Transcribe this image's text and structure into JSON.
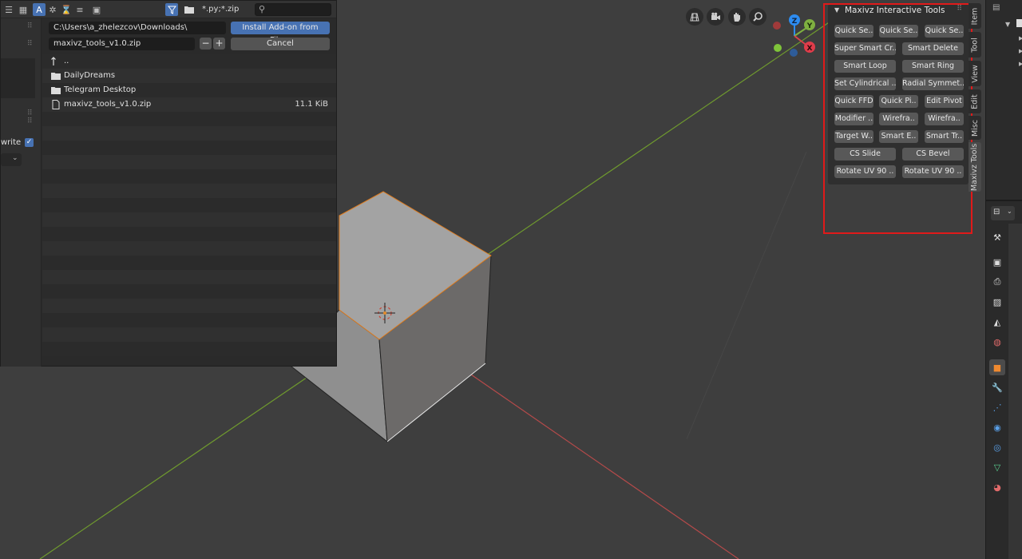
{
  "file_browser": {
    "filter_text": "*.py;*.zip",
    "directory_path": "C:\\Users\\a_zhelezcov\\Downloads\\",
    "filename": "maxivz_tools_v1.0.zip",
    "install_button": "Install Add-on from File...",
    "cancel_button": "Cancel",
    "decrement_label": "−",
    "increment_label": "+",
    "overwrite_label": "write",
    "files": [
      {
        "name": "..",
        "type": "parent",
        "size": ""
      },
      {
        "name": "DailyDreams",
        "type": "folder",
        "size": ""
      },
      {
        "name": "Telegram Desktop",
        "type": "folder",
        "size": ""
      },
      {
        "name": "maxivz_tools_v1.0.zip",
        "type": "file",
        "size": "11.1 KiB"
      }
    ]
  },
  "panel": {
    "title": "Maxivz Interactive Tools",
    "buttons": [
      "Quick Se..",
      "Quick Se..",
      "Quick Se..",
      "Super Smart Cr..",
      "Smart Delete",
      "Smart Loop",
      "Smart Ring",
      "Set Cylindrical ..",
      "Radial Symmet..",
      "Quick FFD",
      "Quick Pi..",
      "Edit Pivot",
      "Modifier ..",
      "Wirefra..",
      "Wirefra..",
      "Target W..",
      "Smart E..",
      "Smart Tr..",
      "CS Slide",
      "CS Bevel",
      "Rotate UV 90 ..",
      "Rotate UV 90 .."
    ]
  },
  "sidebar_tabs": [
    "Item",
    "Tool",
    "View",
    "Edit",
    "Misc",
    "Maxivz Tools"
  ],
  "gizmo": {
    "z_label": "Z",
    "y_label": "Y",
    "x_label": "X"
  },
  "colors": {
    "accent": "#4772b3",
    "highlight": "#e01a1a",
    "x_axis": "#d8414a",
    "y_axis": "#8bc34a",
    "z_axis": "#2d8cf0"
  }
}
